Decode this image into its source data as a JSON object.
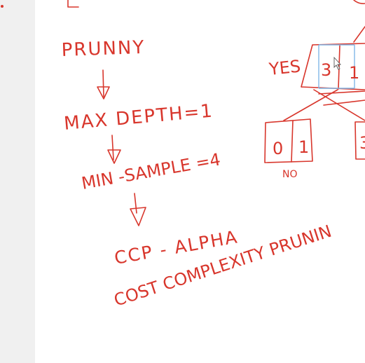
{
  "notes": {
    "pruning": "PRUNNY",
    "max_depth": "MAX DEPTH=1",
    "min_sample": "MIN -SAMPLE =4",
    "ccp_alpha": "CCP - ALPHA",
    "cost_complexity": "COST COMPLEXITY PRUNIN"
  },
  "tree": {
    "yes_label": "YES",
    "no_label": "NO",
    "top_node_values": [
      "3",
      "1"
    ],
    "left_leaf_values": [
      "0",
      "1"
    ],
    "right_leaf_value": "3"
  },
  "colors": {
    "ink": "#d8362c",
    "highlight": "#7fb6e6",
    "gutter": "#f0f0f0",
    "gutter_dot": "#d8362c"
  }
}
